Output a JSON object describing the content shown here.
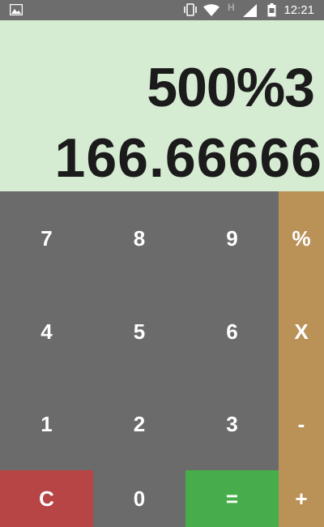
{
  "status_bar": {
    "time": "12:21",
    "network_type": "H",
    "icons": [
      "image-icon",
      "vibrate-icon",
      "wifi-icon",
      "signal-icon",
      "battery-icon"
    ]
  },
  "display": {
    "expression": "500%3",
    "result": "166.66666"
  },
  "keypad": {
    "rows": [
      [
        "7",
        "8",
        "9",
        "%"
      ],
      [
        "4",
        "5",
        "6",
        "X"
      ],
      [
        "1",
        "2",
        "3",
        "-"
      ],
      [
        "C",
        "0",
        "=",
        "+"
      ]
    ]
  },
  "colors": {
    "display_bg": "#d6ecd2",
    "number_key_bg": "#6b6b6b",
    "operator_key_bg": "#ba9258",
    "clear_key_bg": "#b84545",
    "equals_key_bg": "#47ad4a"
  }
}
